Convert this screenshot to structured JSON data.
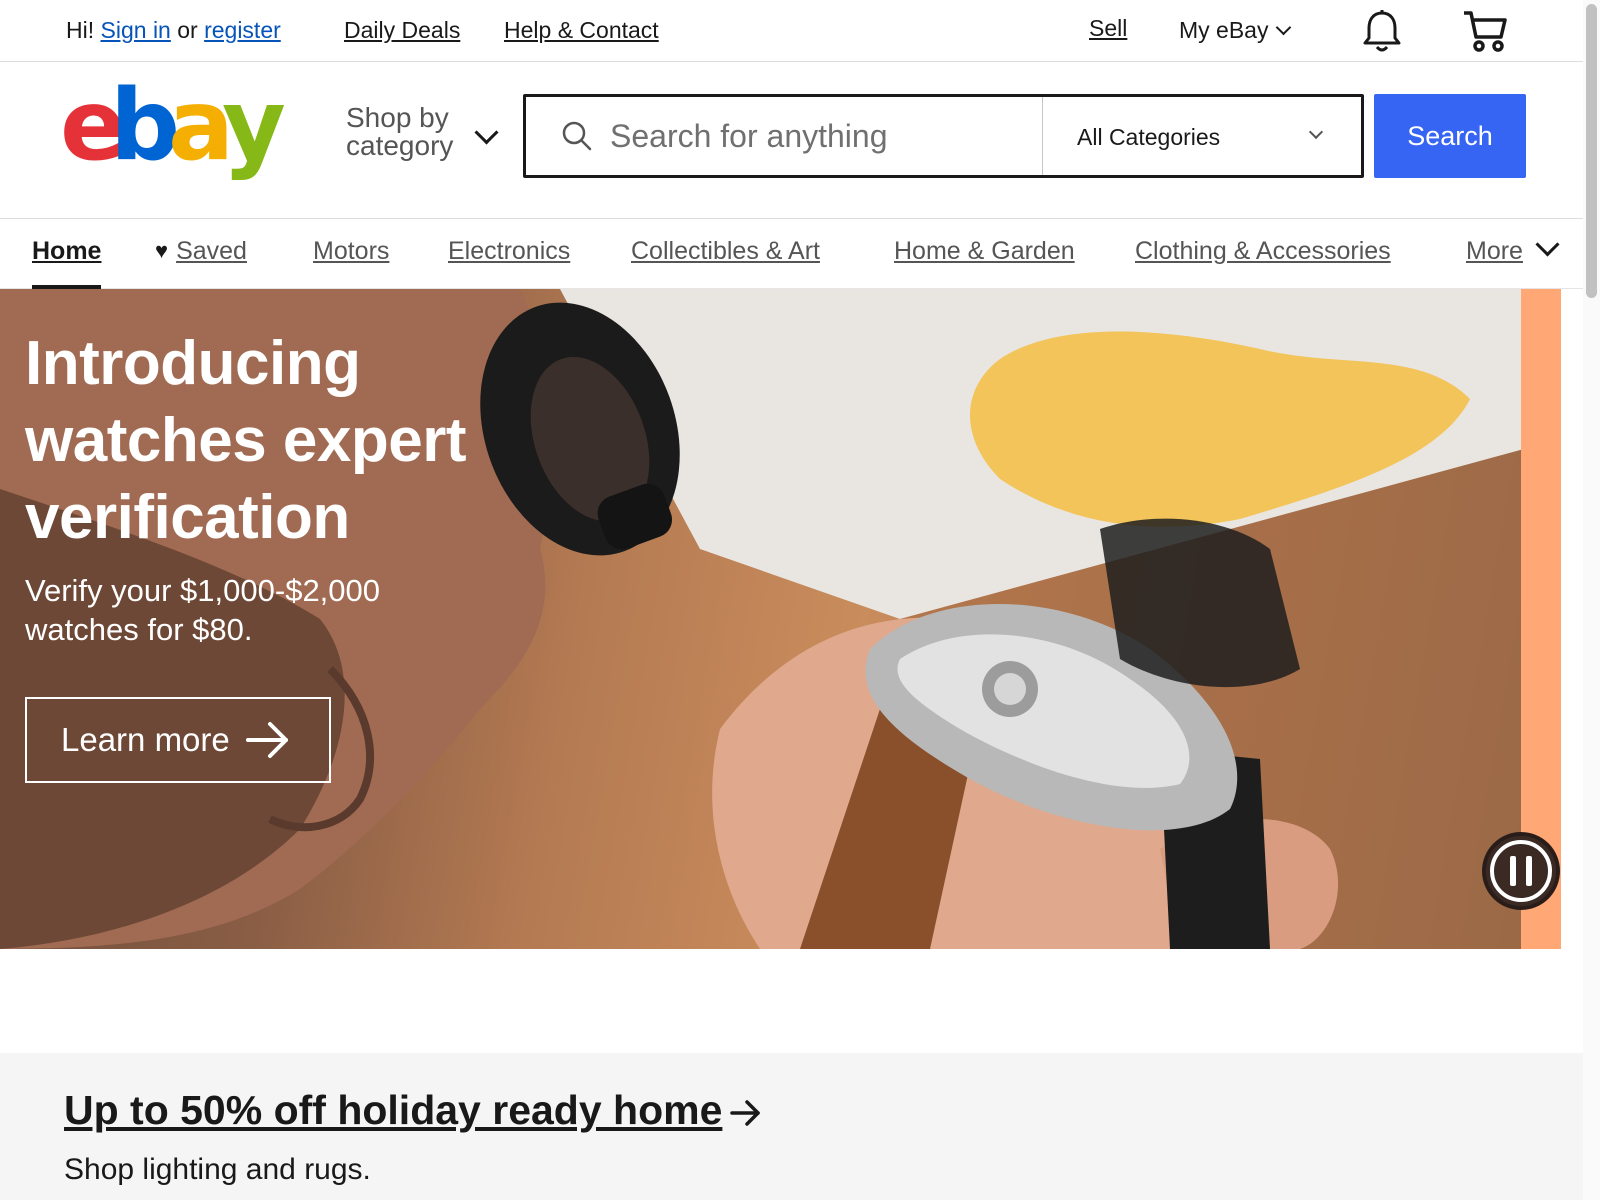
{
  "topbar": {
    "greeting_prefix": "Hi!",
    "sign_in": "Sign in",
    "or_text": "or",
    "register": "register",
    "daily_deals": "Daily Deals",
    "help_contact": "Help & Contact",
    "sell": "Sell",
    "my_ebay": "My eBay"
  },
  "header": {
    "logo": {
      "letters": [
        "e",
        "b",
        "a",
        "y"
      ],
      "colors": [
        "#e53238",
        "#0064d2",
        "#f5af02",
        "#86b817"
      ]
    },
    "shop_by_line1": "Shop by",
    "shop_by_line2": "category",
    "search_placeholder": "Search for anything",
    "category_selected": "All Categories",
    "search_button": "Search",
    "accent_color": "#3665f3"
  },
  "nav": {
    "tabs": [
      {
        "label": "Home",
        "active": true
      },
      {
        "label": "Saved",
        "icon": "heart-icon"
      },
      {
        "label": "Motors"
      },
      {
        "label": "Electronics"
      },
      {
        "label": "Collectibles & Art"
      },
      {
        "label": "Home & Garden"
      },
      {
        "label": "Clothing & Accessories"
      },
      {
        "label": "More"
      }
    ]
  },
  "hero": {
    "title": "Introducing watches expert verification",
    "subtitle": "Verify your $1,000-$2,000 watches for $80.",
    "cta": "Learn more",
    "pause_icon": "pause-icon"
  },
  "promo": {
    "title": "Up to 50% off holiday ready home",
    "subtitle": "Shop lighting and rugs."
  }
}
